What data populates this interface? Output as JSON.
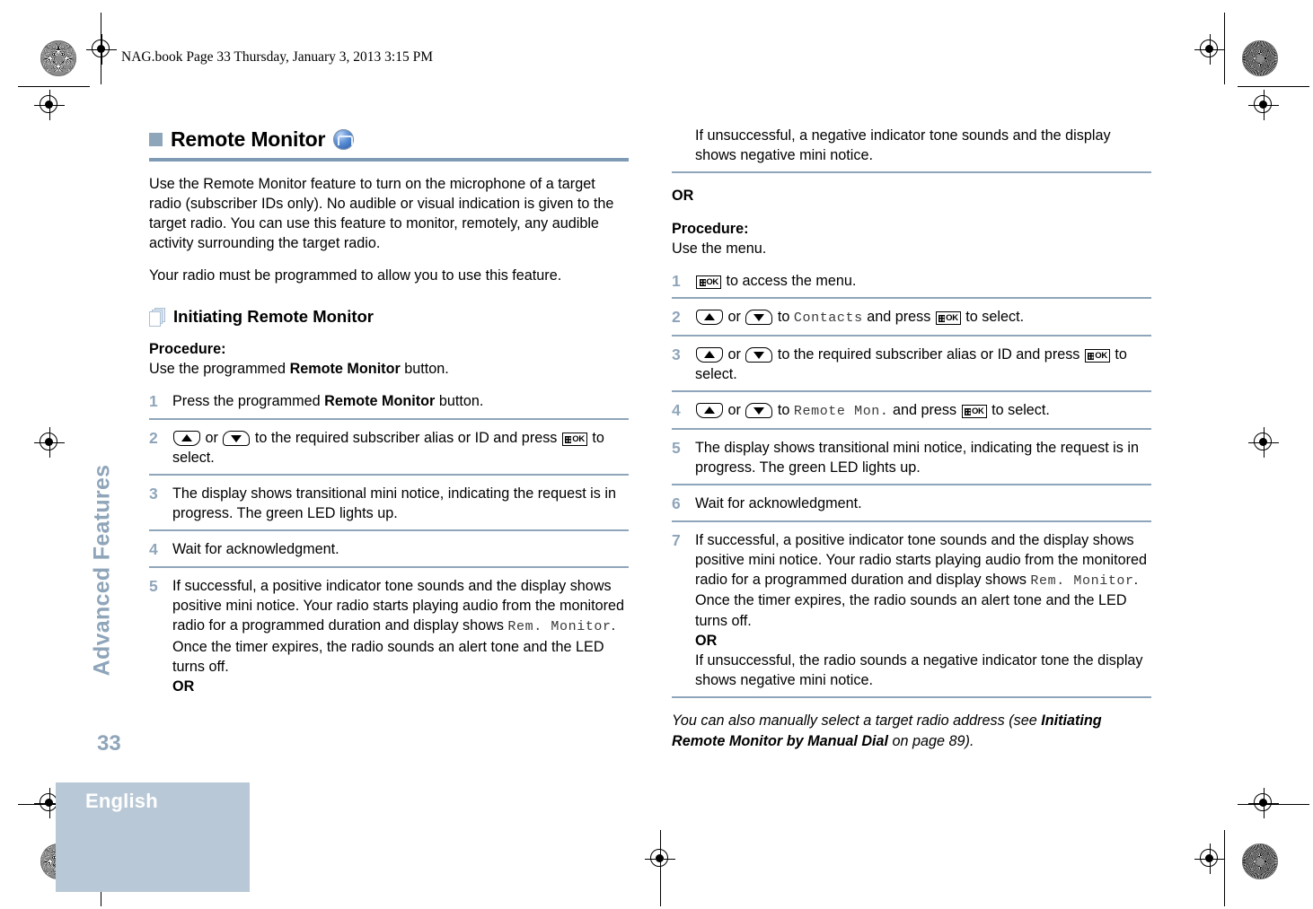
{
  "running_header": "NAG.book  Page 33  Thursday, January 3, 2013  3:15 PM",
  "sidebar": {
    "chapter": "Advanced Features",
    "page_number": "33",
    "language_tab": "English"
  },
  "icons": {
    "feature_icon": "remote-monitor-feature-icon",
    "section_icon": "stacked-pages-icon",
    "key_up": "navigate-up-key-icon",
    "key_down": "navigate-down-key-icon",
    "key_menu_ok": "menu-ok-key-icon"
  },
  "left_column": {
    "title": "Remote Monitor",
    "intro_1": "Use the Remote Monitor feature to turn on the microphone of a target radio (subscriber IDs only). No audible or visual indication is given to the target radio. You can use this feature to monitor, remotely, any audible activity surrounding the target radio.",
    "intro_2": "Your radio must be programmed to allow you to use this feature.",
    "subheading": "Initiating Remote Monitor",
    "procedure_label": "Procedure:",
    "procedure_intro_a": "Use the programmed ",
    "procedure_intro_b": "Remote Monitor",
    "procedure_intro_c": " button.",
    "steps": [
      {
        "num": "1",
        "parts": [
          {
            "type": "text",
            "value": "Press the programmed "
          },
          {
            "type": "bold",
            "value": "Remote Monitor"
          },
          {
            "type": "text",
            "value": " button."
          }
        ]
      },
      {
        "num": "2",
        "parts": [
          {
            "type": "key",
            "value": "up"
          },
          {
            "type": "text",
            "value": " or "
          },
          {
            "type": "key",
            "value": "down"
          },
          {
            "type": "text",
            "value": " to the required subscriber alias or ID and press "
          },
          {
            "type": "key",
            "value": "ok"
          },
          {
            "type": "text",
            "value": " to select."
          }
        ]
      },
      {
        "num": "3",
        "parts": [
          {
            "type": "text",
            "value": "The display shows transitional mini notice, indicating the request is in progress. The green LED lights up."
          }
        ]
      },
      {
        "num": "4",
        "parts": [
          {
            "type": "text",
            "value": "Wait for acknowledgment."
          }
        ]
      },
      {
        "num": "5",
        "parts": [
          {
            "type": "text",
            "value": "If successful, a positive indicator tone sounds and the display shows positive mini notice. Your radio starts playing audio from the monitored radio for a programmed duration and display shows "
          },
          {
            "type": "lcd",
            "value": "Rem. Monitor"
          },
          {
            "type": "text",
            "value": "."
          },
          {
            "type": "break"
          },
          {
            "type": "text",
            "value": "Once the timer expires, the radio sounds an alert tone and the LED turns off."
          },
          {
            "type": "break"
          },
          {
            "type": "bold",
            "value": "OR"
          }
        ]
      }
    ]
  },
  "right_column": {
    "continuation": "If unsuccessful, a negative indicator tone sounds and the display shows negative mini notice.",
    "or_label": "OR",
    "procedure_label": "Procedure:",
    "procedure_intro": "Use the menu.",
    "steps": [
      {
        "num": "1",
        "parts": [
          {
            "type": "key",
            "value": "ok"
          },
          {
            "type": "text",
            "value": " to access the menu."
          }
        ]
      },
      {
        "num": "2",
        "parts": [
          {
            "type": "key",
            "value": "up"
          },
          {
            "type": "text",
            "value": " or "
          },
          {
            "type": "key",
            "value": "down"
          },
          {
            "type": "text",
            "value": " to "
          },
          {
            "type": "lcd",
            "value": "Contacts"
          },
          {
            "type": "text",
            "value": " and press "
          },
          {
            "type": "key",
            "value": "ok"
          },
          {
            "type": "text",
            "value": " to select."
          }
        ]
      },
      {
        "num": "3",
        "parts": [
          {
            "type": "key",
            "value": "up"
          },
          {
            "type": "text",
            "value": " or "
          },
          {
            "type": "key",
            "value": "down"
          },
          {
            "type": "text",
            "value": " to the required subscriber alias or ID and press "
          },
          {
            "type": "key",
            "value": "ok"
          },
          {
            "type": "text",
            "value": " to select."
          }
        ]
      },
      {
        "num": "4",
        "parts": [
          {
            "type": "key",
            "value": "up"
          },
          {
            "type": "text",
            "value": " or "
          },
          {
            "type": "key",
            "value": "down"
          },
          {
            "type": "text",
            "value": " to "
          },
          {
            "type": "lcd",
            "value": "Remote Mon."
          },
          {
            "type": "text",
            "value": " and press "
          },
          {
            "type": "key",
            "value": "ok"
          },
          {
            "type": "text",
            "value": " to select."
          }
        ]
      },
      {
        "num": "5",
        "parts": [
          {
            "type": "text",
            "value": "The display shows transitional mini notice, indicating the request is in progress. The green LED lights up."
          }
        ]
      },
      {
        "num": "6",
        "parts": [
          {
            "type": "text",
            "value": "Wait for acknowledgment."
          }
        ]
      },
      {
        "num": "7",
        "parts": [
          {
            "type": "text",
            "value": "If successful, a positive indicator tone sounds and the display shows positive mini notice. Your radio starts playing audio from the monitored radio for a programmed duration and display shows "
          },
          {
            "type": "lcd",
            "value": "Rem. Monitor"
          },
          {
            "type": "text",
            "value": "."
          },
          {
            "type": "break"
          },
          {
            "type": "text",
            "value": "Once the timer expires, the radio sounds an alert tone and the LED turns off."
          },
          {
            "type": "break"
          },
          {
            "type": "bold",
            "value": "OR"
          },
          {
            "type": "break"
          },
          {
            "type": "text",
            "value": "If unsuccessful, the radio sounds a negative indicator tone the display shows negative mini notice."
          }
        ]
      }
    ],
    "note_parts": [
      {
        "type": "italic",
        "value": "You can also manually select a target radio address (see "
      },
      {
        "type": "bolditalic",
        "value": "Initiating Remote Monitor by Manual Dial"
      },
      {
        "type": "italic",
        "value": " on page 89)."
      }
    ]
  },
  "colors": {
    "accent": "#8fa5ba",
    "rule": "#7f9ab4",
    "tab_background": "#b9c8d6"
  }
}
